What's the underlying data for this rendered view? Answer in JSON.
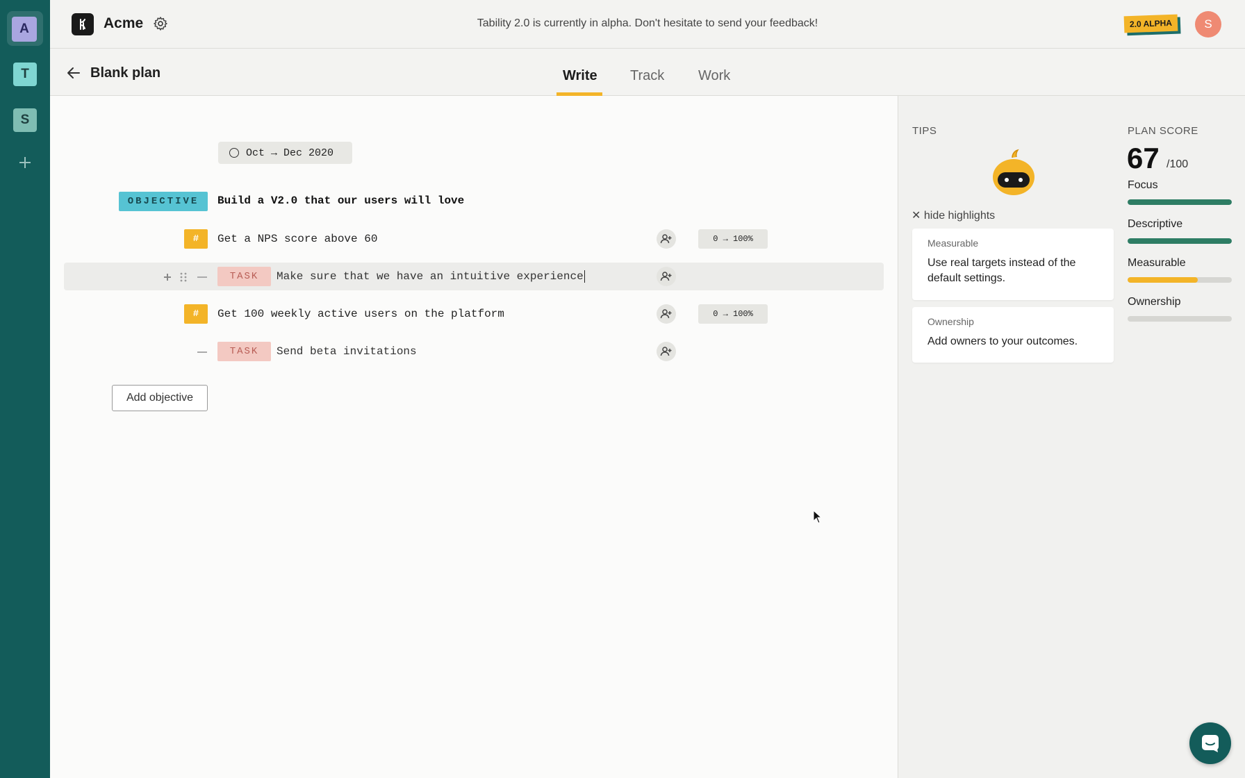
{
  "sidebar": {
    "workspaces": [
      {
        "letter": "A",
        "active": true
      },
      {
        "letter": "T",
        "active": false
      },
      {
        "letter": "S",
        "active": false
      }
    ],
    "add_icon": "plus-icon"
  },
  "header": {
    "org_name": "Acme",
    "banner": "Tability 2.0 is currently in alpha. Don't hesitate to send your feedback!",
    "alpha_badge": "2.0 ALPHA",
    "avatar_letter": "S",
    "settings_icon": "gear-icon"
  },
  "plan": {
    "title": "Blank plan",
    "tabs": [
      {
        "label": "Write",
        "active": true
      },
      {
        "label": "Track",
        "active": false
      },
      {
        "label": "Work",
        "active": false
      }
    ]
  },
  "editor": {
    "date_range": "Oct → Dec 2020",
    "objective": {
      "tag": "OBJECTIVE",
      "text": "Build a V2.0 that our users will love"
    },
    "rows": [
      {
        "kind": "kr",
        "icon": "#",
        "text": "Get a NPS score above 60",
        "range": "0 → 100%"
      },
      {
        "kind": "task",
        "tag": "TASK",
        "text": "Make sure that we have an intuitive experience"
      },
      {
        "kind": "kr",
        "icon": "#",
        "text": "Get 100 weekly active users on the platform",
        "range": "0 → 100%"
      },
      {
        "kind": "task",
        "tag": "TASK",
        "text": "Send beta invitations"
      }
    ],
    "add_objective_label": "Add objective"
  },
  "tips": {
    "heading": "TIPS",
    "hide_label": "hide highlights",
    "cards": [
      {
        "title": "Measurable",
        "body": "Use real targets instead of the default settings."
      },
      {
        "title": "Ownership",
        "body": "Add owners to your outcomes."
      }
    ]
  },
  "plan_score": {
    "heading": "PLAN SCORE",
    "score": "67",
    "out_of": "/100",
    "metrics": [
      {
        "label": "Focus",
        "value": 1.0,
        "color": "#2e7d64"
      },
      {
        "label": "Descriptive",
        "value": 1.0,
        "color": "#2e7d64"
      },
      {
        "label": "Measurable",
        "value": 0.67,
        "color": "#f3b428"
      },
      {
        "label": "Ownership",
        "value": 0.0,
        "color": "#d6d6d2"
      }
    ]
  }
}
